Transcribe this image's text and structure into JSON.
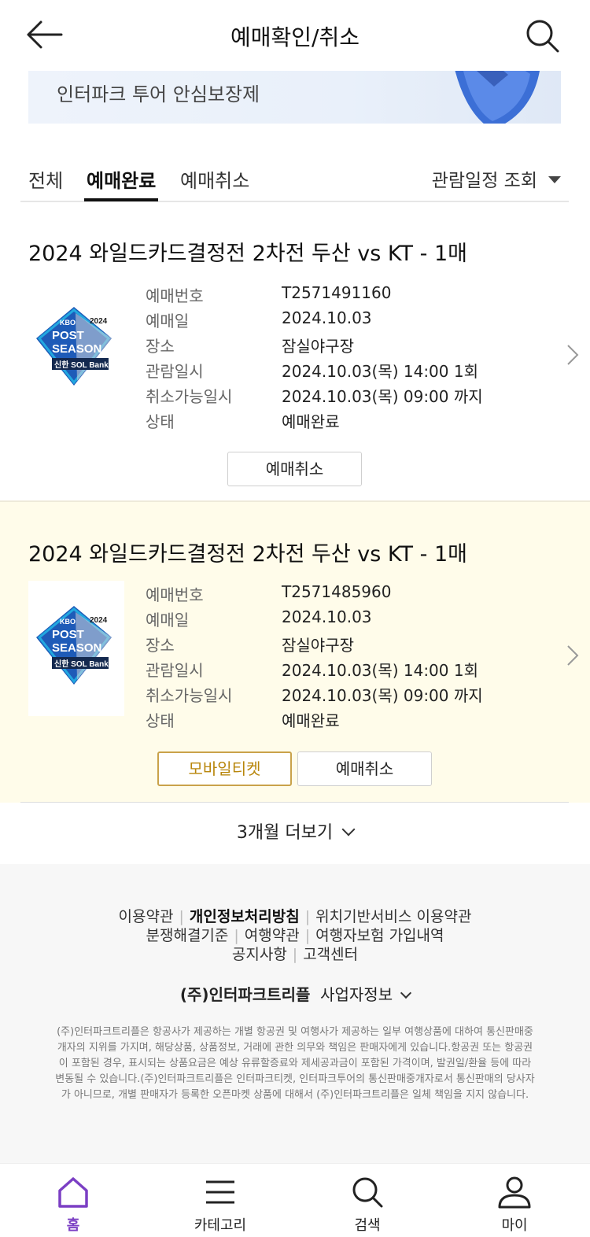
{
  "header": {
    "title": "예매확인/취소"
  },
  "banner": {
    "text": "인터파크 투어 안심보장제"
  },
  "tabs": {
    "items": [
      "전체",
      "예매완료",
      "예매취소"
    ],
    "active": "예매완료",
    "schedule_label": "관람일정 조회"
  },
  "bookings": [
    {
      "title": "2024 와일드카드결정전 2차전 두산 vs KT - 1매",
      "thumb": {
        "kbo": "KBO",
        "line1": "POST",
        "line2": "SEASON",
        "year": "2024",
        "sponsor": "신한 SOL Bank"
      },
      "fields": [
        {
          "label": "예매번호",
          "value": "T2571491160"
        },
        {
          "label": "예매일",
          "value": "2024.10.03"
        },
        {
          "label": "장소",
          "value": "잠실야구장"
        },
        {
          "label": "관람일시",
          "value": "2024.10.03(목) 14:00 1회"
        },
        {
          "label": "취소가능일시",
          "value": "2024.10.03(목) 09:00 까지"
        },
        {
          "label": "상태",
          "value": "예매완료"
        }
      ],
      "buttons": {
        "cancel": "예매취소"
      }
    },
    {
      "title": "2024 와일드카드결정전 2차전 두산 vs KT - 1매",
      "thumb": {
        "kbo": "KBO",
        "line1": "POST",
        "line2": "SEASON",
        "year": "2024",
        "sponsor": "신한 SOL Bank"
      },
      "fields": [
        {
          "label": "예매번호",
          "value": "T2571485960"
        },
        {
          "label": "예매일",
          "value": "2024.10.03"
        },
        {
          "label": "장소",
          "value": "잠실야구장"
        },
        {
          "label": "관람일시",
          "value": "2024.10.03(목) 14:00 1회"
        },
        {
          "label": "취소가능일시",
          "value": "2024.10.03(목) 09:00 까지"
        },
        {
          "label": "상태",
          "value": "예매완료"
        }
      ],
      "buttons": {
        "mobile_ticket": "모바일티켓",
        "cancel": "예매취소"
      }
    }
  ],
  "more": {
    "label": "3개월 더보기"
  },
  "footer": {
    "links_row1": [
      "이용약관",
      "개인정보처리방침",
      "위치기반서비스 이용약관"
    ],
    "links_row2": [
      "분쟁해결기준",
      "여행약관",
      "여행자보험 가입내역"
    ],
    "links_row3": [
      "공지사항",
      "고객센터"
    ],
    "company_name": "(주)인터파크트리플",
    "company_info": "사업자정보",
    "legal": "(주)인터파크트리플은 항공사가 제공하는 개별 항공권 및 여행사가 제공하는 일부 여행상품에 대하여 통신판매중개자의 지위를 가지며, 해당상품, 상품정보, 거래에 관한 의무와 책임은 판매자에게 있습니다.항공권 또는 항공권이 포함된 경우, 표시되는 상품요금은 예상 유류할증료와 제세공과금이 포함된 가격이며, 발권일/환율 등에 따라 변동될 수 있습니다.(주)인터파크트리플은 인터파크티켓, 인터파크투어의 통신판매중개자로서 통신판매의 당사자가 아니므로, 개별 판매자가 등록한 오픈마켓 상품에 대해서 (주)인터파크트리플은 일체 책임을 지지 않습니다."
  },
  "tabbar": {
    "items": [
      "홈",
      "카테고리",
      "검색",
      "마이"
    ],
    "active": "홈"
  },
  "colors": {
    "accent": "#7b3fc4",
    "highlight_bg": "#fffcea",
    "mobile_ticket": "#c9a24a"
  }
}
